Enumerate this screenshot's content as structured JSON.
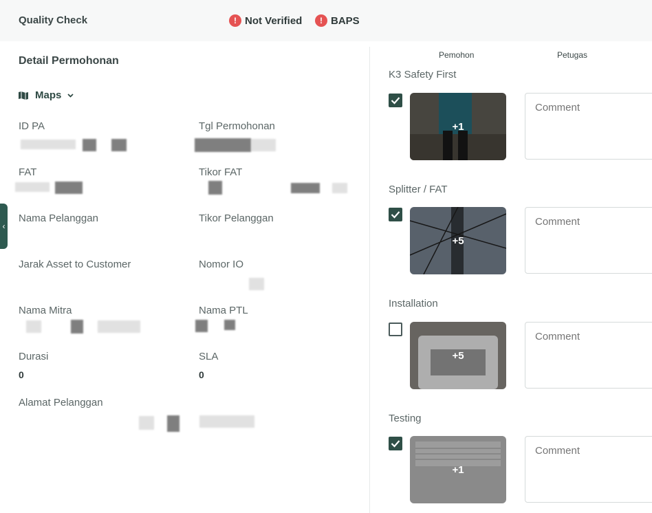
{
  "header": {
    "title": "Quality Check",
    "badges": [
      {
        "icon": "!",
        "label": "Not Verified",
        "color": "#e55353"
      },
      {
        "icon": "!",
        "label": "BAPS",
        "color": "#e55353"
      }
    ]
  },
  "detail": {
    "title": "Detail Permohonan",
    "maps_label": "Maps",
    "fields": {
      "id_pa": {
        "label": "ID PA",
        "value": ""
      },
      "tgl_permohonan": {
        "label": "Tgl Permohonan",
        "value": ""
      },
      "fat": {
        "label": "FAT",
        "value": ""
      },
      "tikor_fat": {
        "label": "Tikor FAT",
        "value": ""
      },
      "nama_pelanggan": {
        "label": "Nama Pelanggan",
        "value": ""
      },
      "tikor_pelanggan": {
        "label": "Tikor Pelanggan",
        "value": ""
      },
      "jarak": {
        "label": "Jarak Asset to Customer",
        "value": ""
      },
      "nomor_io": {
        "label": "Nomor IO",
        "value": ""
      },
      "nama_mitra": {
        "label": "Nama Mitra",
        "value": ""
      },
      "nama_ptl": {
        "label": "Nama PTL",
        "value": ""
      },
      "durasi": {
        "label": "Durasi",
        "value": "0"
      },
      "sla": {
        "label": "SLA",
        "value": "0"
      },
      "alamat": {
        "label": "Alamat Pelanggan",
        "value": ""
      }
    }
  },
  "checks": {
    "col_pemohon": "Pemohon",
    "col_petugas": "Petugas",
    "items": [
      {
        "title": "K3 Safety First",
        "checked": true,
        "photo_count": "+1",
        "comment_placeholder": "Comment"
      },
      {
        "title": "Splitter / FAT",
        "checked": true,
        "photo_count": "+5",
        "comment_placeholder": "Comment"
      },
      {
        "title": "Installation",
        "checked": false,
        "photo_count": "+5",
        "comment_placeholder": "Comment"
      },
      {
        "title": "Testing",
        "checked": true,
        "photo_count": "+1",
        "comment_placeholder": "Comment"
      }
    ]
  },
  "colors": {
    "accent": "#2f4f47",
    "badge_red": "#e55353",
    "panel_bg": "#f7f8f8"
  }
}
